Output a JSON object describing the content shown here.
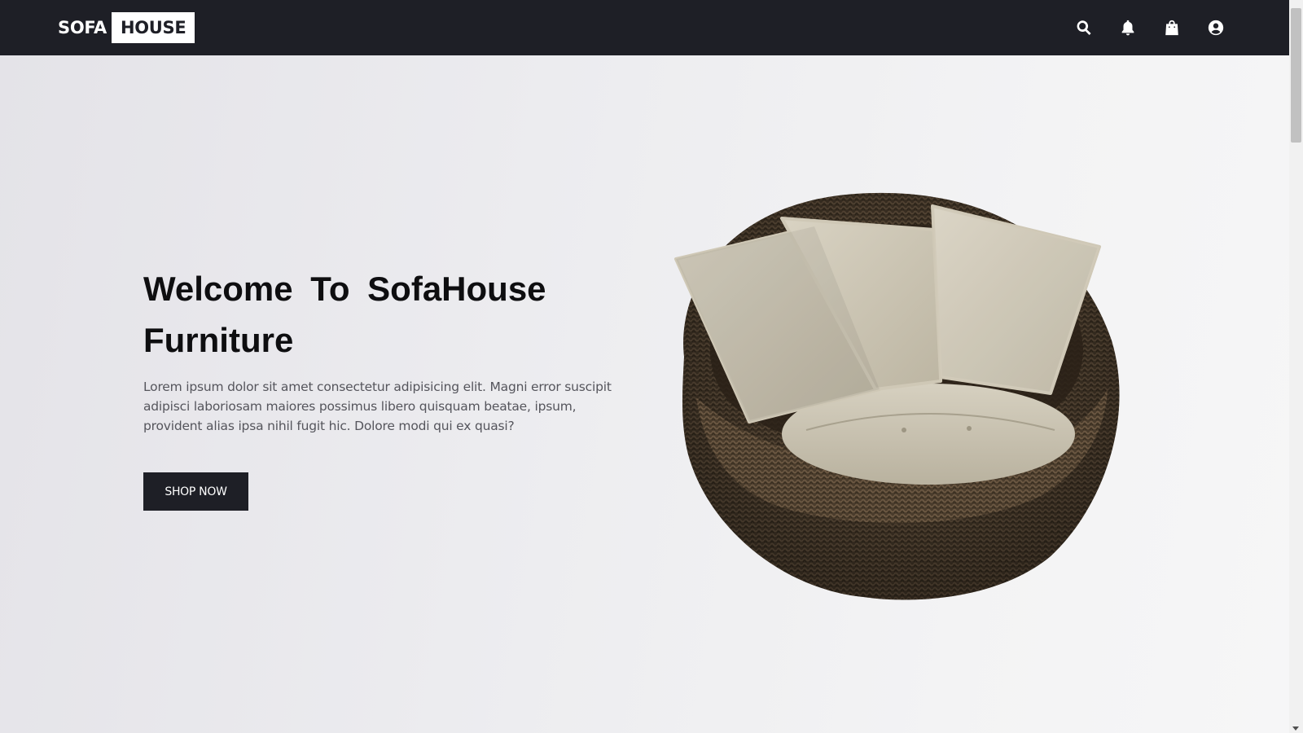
{
  "navbar": {
    "logo_part_a": "SOFA",
    "logo_part_b": "HOUSE",
    "icons": [
      "search-icon",
      "bell-icon",
      "shopping-bag-icon",
      "user-circle-icon"
    ],
    "bg_color": "#1e1f26"
  },
  "hero": {
    "title": "Welcome To SofaHouse Furniture",
    "text": "Lorem ipsum dolor sit amet consectetur adipisicing elit. Magni error suscipit adipisci laboriosam maiores possimus libero quisquam beatae, ipsum, provident alias ipsa nihil fugit hic. Dolore modi qui ex quasi?",
    "button_label": "SHOP NOW",
    "image": "wicker-egg-chair-with-cushions"
  },
  "colors": {
    "accent": "#1e1f26",
    "background": "#e6e5ea"
  }
}
